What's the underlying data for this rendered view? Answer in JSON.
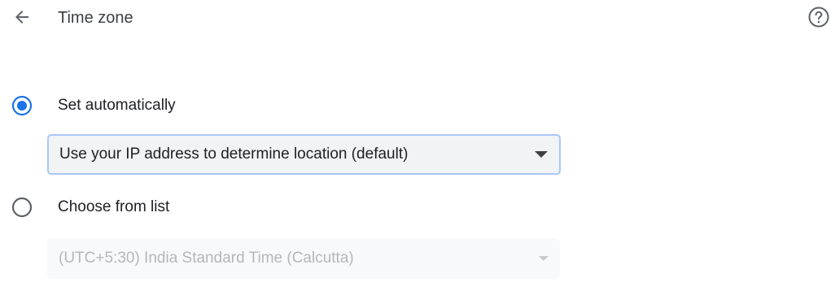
{
  "header": {
    "title": "Time zone",
    "back_icon": "arrow-back-icon",
    "help_icon": "help-circle-icon"
  },
  "options": {
    "auto": {
      "label": "Set automatically",
      "selected": true
    },
    "list": {
      "label": "Choose from list",
      "selected": false
    }
  },
  "auto_select": {
    "value": "Use your IP address to determine location (default)",
    "enabled": true
  },
  "list_select": {
    "value": "(UTC+5:30) India Standard Time (Calcutta)",
    "enabled": false
  },
  "colors": {
    "accent": "#1a73e8",
    "focus_border": "#a8c7fa",
    "text": "#202124",
    "disabled_text": "#b4b7bb"
  }
}
